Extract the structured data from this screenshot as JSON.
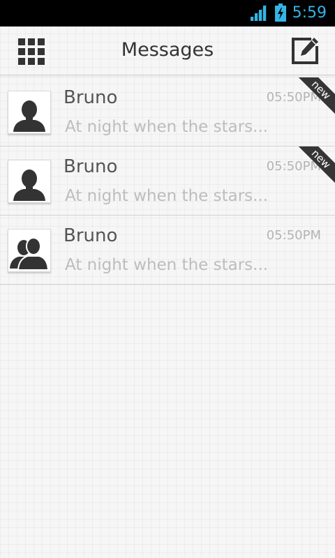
{
  "status_bar": {
    "time": "5:59",
    "signal_icon": "signal-icon",
    "battery_icon": "battery-charging-icon",
    "accent_color": "#33b5e5"
  },
  "action_bar": {
    "title": "Messages",
    "menu_icon": "grid-icon",
    "compose_icon": "compose-icon"
  },
  "conversations": [
    {
      "name": "Bruno",
      "time": "05:50PM",
      "preview": "At night when the stars...",
      "badge": "new",
      "avatar": "person-icon"
    },
    {
      "name": "Bruno",
      "time": "05:50PM",
      "preview": "At night when the stars...",
      "badge": "new",
      "avatar": "person-icon"
    },
    {
      "name": "Bruno",
      "time": "05:50PM",
      "preview": "At night when the stars...",
      "badge": "",
      "avatar": "group-icon"
    }
  ]
}
